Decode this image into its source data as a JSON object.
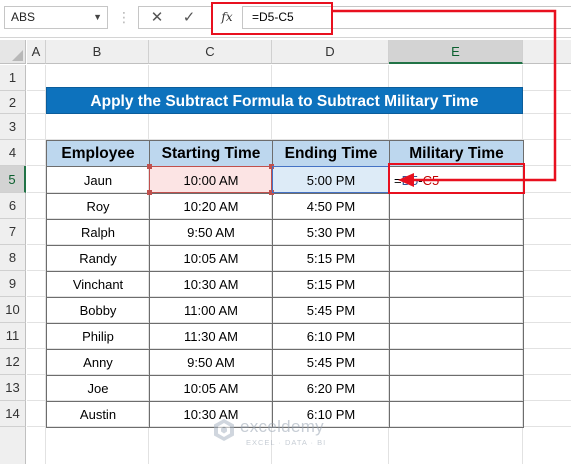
{
  "formula_bar": {
    "name_box": "ABS",
    "cancel_icon": "✕",
    "enter_icon": "✓",
    "fx_label": "fx",
    "formula": "=D5-C5"
  },
  "columns": [
    "A",
    "B",
    "C",
    "D",
    "E"
  ],
  "selected_column": "E",
  "rows": [
    "1",
    "2",
    "3",
    "4",
    "5",
    "6",
    "7",
    "8",
    "9",
    "10",
    "11",
    "12",
    "13",
    "14"
  ],
  "selected_row": "5",
  "title": "Apply the Subtract Formula to Subtract Military Time",
  "table": {
    "headers": [
      "Employee",
      "Starting Time",
      "Ending Time",
      "Military Time"
    ],
    "rows": [
      [
        "Jaun",
        "10:00 AM",
        "5:00 PM",
        ""
      ],
      [
        "Roy",
        "10:20 AM",
        "4:50 PM",
        ""
      ],
      [
        "Ralph",
        "9:50 AM",
        "5:30 PM",
        ""
      ],
      [
        "Randy",
        "10:05 AM",
        "5:15 PM",
        ""
      ],
      [
        "Vinchant",
        "10:30 AM",
        "5:15 PM",
        ""
      ],
      [
        "Bobby",
        "11:00 AM",
        "5:45 PM",
        ""
      ],
      [
        "Philip",
        "11:30 AM",
        "6:10 PM",
        ""
      ],
      [
        "Anny",
        "9:50 AM",
        "5:45 PM",
        ""
      ],
      [
        "Joe",
        "10:05 AM",
        "6:20 PM",
        ""
      ],
      [
        "Austin",
        "10:30 AM",
        "6:10 PM",
        ""
      ]
    ],
    "editing_cell": {
      "eq": "=",
      "ref1": "D5",
      "op": "-",
      "ref2": "C5"
    }
  },
  "watermark": {
    "name": "exceldemy",
    "tagline": "EXCEL · DATA · BI"
  },
  "colors": {
    "title_bg": "#0d72bd",
    "header_bg": "#bdd7ee",
    "highlight": "#e8101f",
    "ref_c": "#c00000",
    "ref_d": "#2f5597"
  }
}
